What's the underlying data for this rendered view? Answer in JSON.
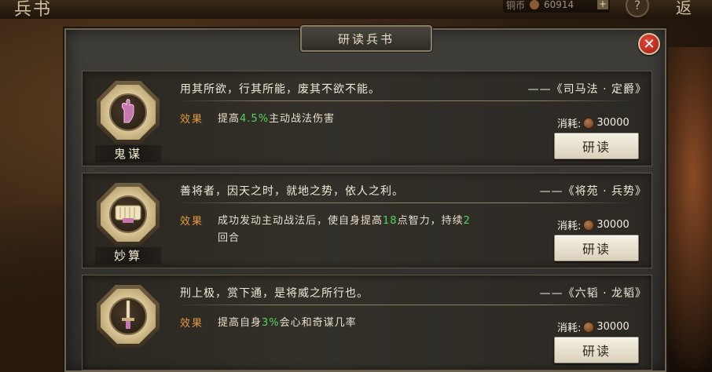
{
  "background": {
    "page_title": "兵书",
    "currency_value": "60914",
    "back_label": "返"
  },
  "modal": {
    "title": "研读兵书"
  },
  "cards": [
    {
      "badge_label": "鬼谋",
      "quote": "用其所欲，行其所能，废其不欲不能。",
      "source": "——《司马法 · 定爵》",
      "effect_label": "效果",
      "effect_pre": "提高",
      "effect_value": "4.5%",
      "effect_post": "主动战法伤害",
      "effect_value2": "",
      "effect_post2": "",
      "cost_label": "消耗:",
      "cost_value": "30000",
      "button_label": "研读"
    },
    {
      "badge_label": "妙算",
      "quote": "善将者，因天之时，就地之势，依人之利。",
      "source": "——《将苑 · 兵势》",
      "effect_label": "效果",
      "effect_pre": "成功发动主动战法后，使自身提高",
      "effect_value": "18",
      "effect_post": "点智力，持续",
      "effect_value2": "2",
      "effect_post2": "回合",
      "cost_label": "消耗:",
      "cost_value": "30000",
      "button_label": "研读"
    },
    {
      "badge_label": "",
      "quote": "刑上极，赏下通，是将威之所行也。",
      "source": "——《六韬 · 龙韬》",
      "effect_label": "效果",
      "effect_pre": "提高自身",
      "effect_value": "3%",
      "effect_post": "会心和奇谋几率",
      "effect_value2": "",
      "effect_post2": "",
      "cost_label": "消耗:",
      "cost_value": "30000",
      "button_label": "研读"
    }
  ],
  "colors": {
    "accent_orange": "#e49a3a",
    "highlight_green": "#4fd65a",
    "close_red": "#e6483a"
  },
  "icons": [
    "close-icon",
    "hand-gesture-icon",
    "scroll-icon",
    "sword-icon",
    "coin-icon"
  ]
}
